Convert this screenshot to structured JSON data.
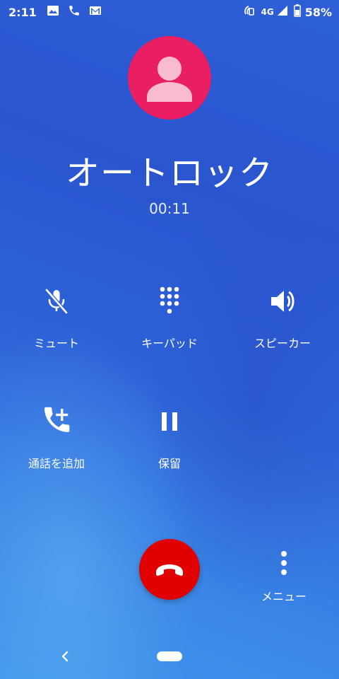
{
  "status_bar": {
    "time": "2:11",
    "network": "4G",
    "battery": "58%",
    "icons": [
      "image-icon",
      "phone-icon",
      "gmail-icon",
      "nfc-icon",
      "signal-icon",
      "battery-icon"
    ]
  },
  "caller": {
    "name": "オートロック",
    "duration": "00:11",
    "avatar_color": "#e91e63"
  },
  "actions": {
    "mute": "ミュート",
    "keypad": "キーパッド",
    "speaker": "スピーカー",
    "add_call": "通話を追加",
    "hold": "保留"
  },
  "end_call": {
    "color": "#e00000"
  },
  "menu": {
    "label": "メニュー"
  }
}
